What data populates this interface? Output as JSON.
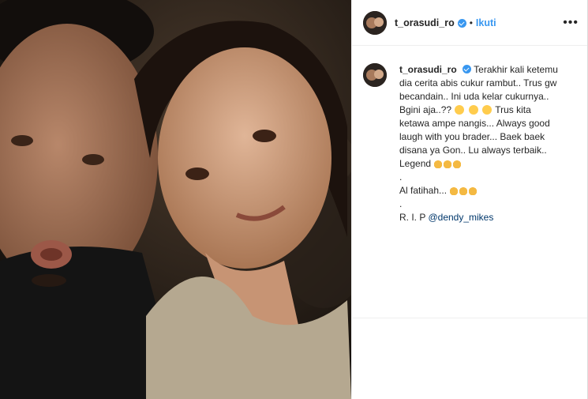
{
  "post": {
    "username": "t_orasudi_ro",
    "follow_label": "Ikuti",
    "dot": "•",
    "more_label": "•••"
  },
  "caption": {
    "username": "t_orasudi_ro",
    "lines": [
      "Terakhir kali ketemu",
      "dia cerita abis cukur rambut.. Trus gw",
      "becandain.. Ini uda kelar cukurnya..",
      "Bgini aja..??",
      "Trus kita",
      "ketawa ampe nangis... Always good",
      "laugh with you brader... Baek baek",
      "disana ya Gon.. Lu always terbaik..",
      "Legend",
      ".",
      "Al fatihah...",
      ".",
      "R. I. P",
      "@dendy_mikes"
    ]
  },
  "icons": {
    "verified": "verified-badge-icon",
    "more": "more-options-icon",
    "emoji": "grinning-face-icon",
    "pray": "folded-hands-icon"
  },
  "colors": {
    "link": "#3897f0",
    "mention": "#00376b",
    "text": "#262626"
  }
}
